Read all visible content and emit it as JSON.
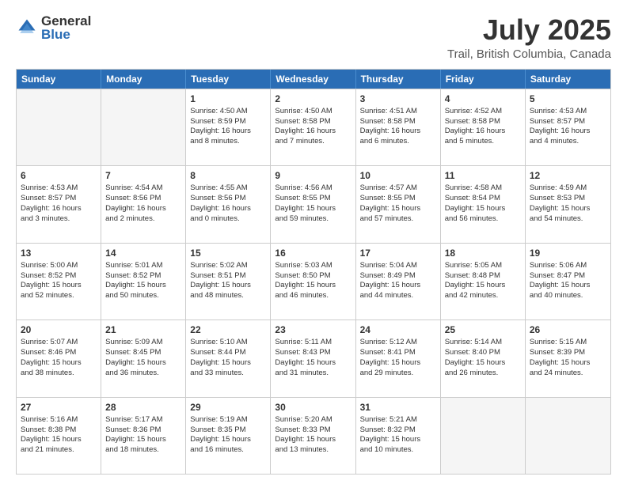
{
  "header": {
    "logo_general": "General",
    "logo_blue": "Blue",
    "title": "July 2025",
    "subtitle": "Trail, British Columbia, Canada"
  },
  "days_of_week": [
    "Sunday",
    "Monday",
    "Tuesday",
    "Wednesday",
    "Thursday",
    "Friday",
    "Saturday"
  ],
  "weeks": [
    [
      {
        "num": "",
        "lines": [],
        "empty": true
      },
      {
        "num": "",
        "lines": [],
        "empty": true
      },
      {
        "num": "1",
        "lines": [
          "Sunrise: 4:50 AM",
          "Sunset: 8:59 PM",
          "Daylight: 16 hours",
          "and 8 minutes."
        ]
      },
      {
        "num": "2",
        "lines": [
          "Sunrise: 4:50 AM",
          "Sunset: 8:58 PM",
          "Daylight: 16 hours",
          "and 7 minutes."
        ]
      },
      {
        "num": "3",
        "lines": [
          "Sunrise: 4:51 AM",
          "Sunset: 8:58 PM",
          "Daylight: 16 hours",
          "and 6 minutes."
        ]
      },
      {
        "num": "4",
        "lines": [
          "Sunrise: 4:52 AM",
          "Sunset: 8:58 PM",
          "Daylight: 16 hours",
          "and 5 minutes."
        ]
      },
      {
        "num": "5",
        "lines": [
          "Sunrise: 4:53 AM",
          "Sunset: 8:57 PM",
          "Daylight: 16 hours",
          "and 4 minutes."
        ]
      }
    ],
    [
      {
        "num": "6",
        "lines": [
          "Sunrise: 4:53 AM",
          "Sunset: 8:57 PM",
          "Daylight: 16 hours",
          "and 3 minutes."
        ]
      },
      {
        "num": "7",
        "lines": [
          "Sunrise: 4:54 AM",
          "Sunset: 8:56 PM",
          "Daylight: 16 hours",
          "and 2 minutes."
        ]
      },
      {
        "num": "8",
        "lines": [
          "Sunrise: 4:55 AM",
          "Sunset: 8:56 PM",
          "Daylight: 16 hours",
          "and 0 minutes."
        ]
      },
      {
        "num": "9",
        "lines": [
          "Sunrise: 4:56 AM",
          "Sunset: 8:55 PM",
          "Daylight: 15 hours",
          "and 59 minutes."
        ]
      },
      {
        "num": "10",
        "lines": [
          "Sunrise: 4:57 AM",
          "Sunset: 8:55 PM",
          "Daylight: 15 hours",
          "and 57 minutes."
        ]
      },
      {
        "num": "11",
        "lines": [
          "Sunrise: 4:58 AM",
          "Sunset: 8:54 PM",
          "Daylight: 15 hours",
          "and 56 minutes."
        ]
      },
      {
        "num": "12",
        "lines": [
          "Sunrise: 4:59 AM",
          "Sunset: 8:53 PM",
          "Daylight: 15 hours",
          "and 54 minutes."
        ]
      }
    ],
    [
      {
        "num": "13",
        "lines": [
          "Sunrise: 5:00 AM",
          "Sunset: 8:52 PM",
          "Daylight: 15 hours",
          "and 52 minutes."
        ]
      },
      {
        "num": "14",
        "lines": [
          "Sunrise: 5:01 AM",
          "Sunset: 8:52 PM",
          "Daylight: 15 hours",
          "and 50 minutes."
        ]
      },
      {
        "num": "15",
        "lines": [
          "Sunrise: 5:02 AM",
          "Sunset: 8:51 PM",
          "Daylight: 15 hours",
          "and 48 minutes."
        ]
      },
      {
        "num": "16",
        "lines": [
          "Sunrise: 5:03 AM",
          "Sunset: 8:50 PM",
          "Daylight: 15 hours",
          "and 46 minutes."
        ]
      },
      {
        "num": "17",
        "lines": [
          "Sunrise: 5:04 AM",
          "Sunset: 8:49 PM",
          "Daylight: 15 hours",
          "and 44 minutes."
        ]
      },
      {
        "num": "18",
        "lines": [
          "Sunrise: 5:05 AM",
          "Sunset: 8:48 PM",
          "Daylight: 15 hours",
          "and 42 minutes."
        ]
      },
      {
        "num": "19",
        "lines": [
          "Sunrise: 5:06 AM",
          "Sunset: 8:47 PM",
          "Daylight: 15 hours",
          "and 40 minutes."
        ]
      }
    ],
    [
      {
        "num": "20",
        "lines": [
          "Sunrise: 5:07 AM",
          "Sunset: 8:46 PM",
          "Daylight: 15 hours",
          "and 38 minutes."
        ]
      },
      {
        "num": "21",
        "lines": [
          "Sunrise: 5:09 AM",
          "Sunset: 8:45 PM",
          "Daylight: 15 hours",
          "and 36 minutes."
        ]
      },
      {
        "num": "22",
        "lines": [
          "Sunrise: 5:10 AM",
          "Sunset: 8:44 PM",
          "Daylight: 15 hours",
          "and 33 minutes."
        ]
      },
      {
        "num": "23",
        "lines": [
          "Sunrise: 5:11 AM",
          "Sunset: 8:43 PM",
          "Daylight: 15 hours",
          "and 31 minutes."
        ]
      },
      {
        "num": "24",
        "lines": [
          "Sunrise: 5:12 AM",
          "Sunset: 8:41 PM",
          "Daylight: 15 hours",
          "and 29 minutes."
        ]
      },
      {
        "num": "25",
        "lines": [
          "Sunrise: 5:14 AM",
          "Sunset: 8:40 PM",
          "Daylight: 15 hours",
          "and 26 minutes."
        ]
      },
      {
        "num": "26",
        "lines": [
          "Sunrise: 5:15 AM",
          "Sunset: 8:39 PM",
          "Daylight: 15 hours",
          "and 24 minutes."
        ]
      }
    ],
    [
      {
        "num": "27",
        "lines": [
          "Sunrise: 5:16 AM",
          "Sunset: 8:38 PM",
          "Daylight: 15 hours",
          "and 21 minutes."
        ]
      },
      {
        "num": "28",
        "lines": [
          "Sunrise: 5:17 AM",
          "Sunset: 8:36 PM",
          "Daylight: 15 hours",
          "and 18 minutes."
        ]
      },
      {
        "num": "29",
        "lines": [
          "Sunrise: 5:19 AM",
          "Sunset: 8:35 PM",
          "Daylight: 15 hours",
          "and 16 minutes."
        ]
      },
      {
        "num": "30",
        "lines": [
          "Sunrise: 5:20 AM",
          "Sunset: 8:33 PM",
          "Daylight: 15 hours",
          "and 13 minutes."
        ]
      },
      {
        "num": "31",
        "lines": [
          "Sunrise: 5:21 AM",
          "Sunset: 8:32 PM",
          "Daylight: 15 hours",
          "and 10 minutes."
        ]
      },
      {
        "num": "",
        "lines": [],
        "empty": true
      },
      {
        "num": "",
        "lines": [],
        "empty": true
      }
    ]
  ]
}
